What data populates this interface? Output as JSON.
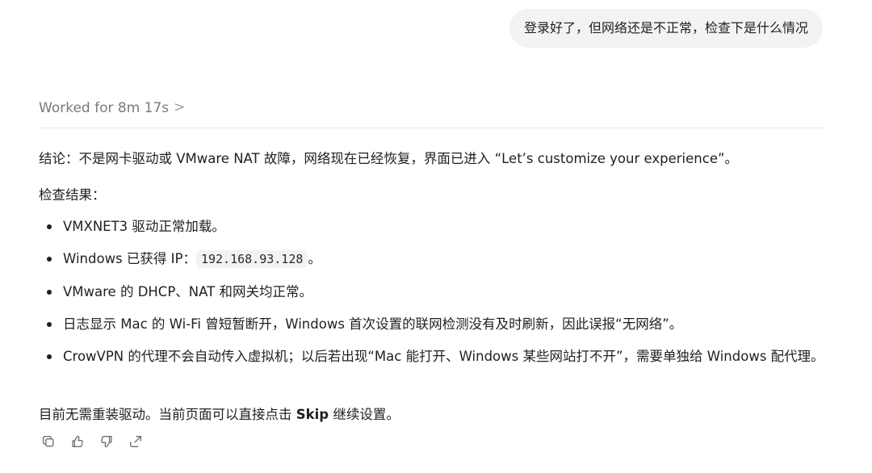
{
  "user_message": "登录好了，但网络还是不正常，检查下是什么情况",
  "worked": {
    "label": "Worked for 8m 17s",
    "chevron": ">"
  },
  "reply": {
    "conclusion": "结论：不是网卡驱动或 VMware NAT 故障，网络现在已经恢复，界面已进入 “Let’s customize your experience”。",
    "results_heading": "检查结果：",
    "bullets": {
      "b1": "VMXNET3 驱动正常加载。",
      "b2_prefix": "Windows 已获得 IP：",
      "b2_ip": "192.168.93.128",
      "b2_suffix": "。",
      "b3": "VMware 的 DHCP、NAT 和网关均正常。",
      "b4": "日志显示 Mac 的 Wi-Fi 曾短暂断开，Windows 首次设置的联网检测没有及时刷新，因此误报“无网络”。",
      "b5": "CrowVPN 的代理不会自动传入虚拟机；以后若出现“Mac 能打开、Windows 某些网站打不开”，需要单独给 Windows 配代理。"
    },
    "final_prefix": "目前无需重装驱动。当前页面可以直接点击 ",
    "final_bold": "Skip",
    "final_suffix": " 继续设置。"
  },
  "actions": {
    "icons": [
      "copy-icon",
      "thumbs-up-icon",
      "thumbs-down-icon",
      "share-icon"
    ]
  }
}
